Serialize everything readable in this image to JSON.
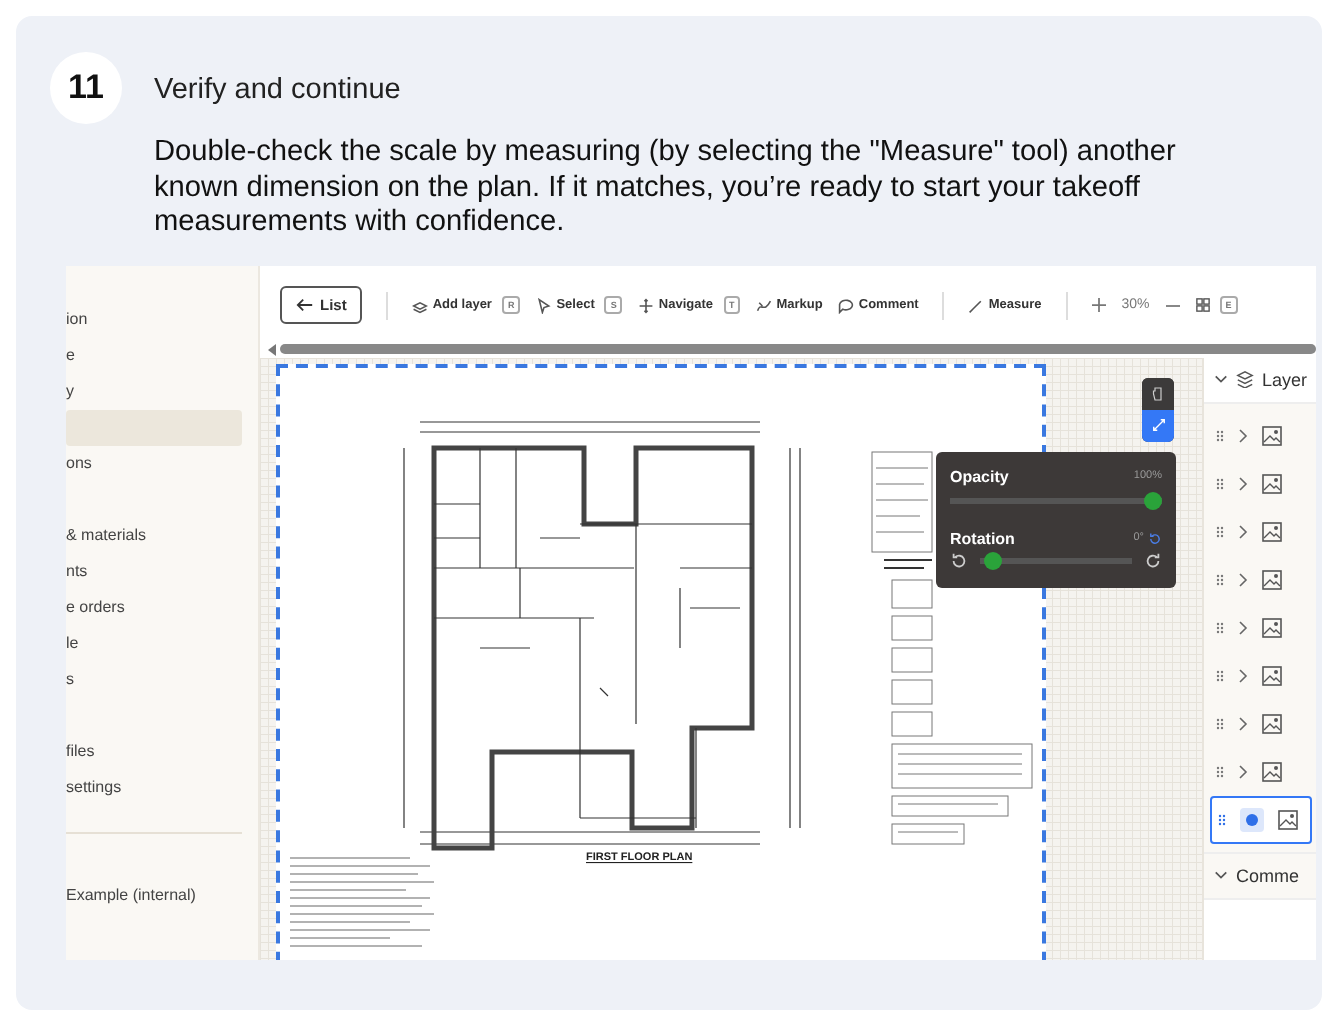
{
  "step": {
    "number": "11",
    "title": "Verify and continue",
    "text": "Double-check the scale by measuring (by selecting the \"Measure\" tool) another known dimension on the plan. If it matches, you’re ready to start your takeoff measurements with confidence."
  },
  "app": {
    "sidebar": {
      "groups": [
        {
          "items": [
            {
              "label": "ion",
              "selected": false
            },
            {
              "label": "e",
              "selected": false
            },
            {
              "label": "y",
              "selected": false
            },
            {
              "selected": true
            },
            {
              "label": "ons",
              "selected": false
            }
          ]
        },
        {
          "items": [
            {
              "label": "& materials",
              "selected": false
            },
            {
              "label": "nts",
              "selected": false
            },
            {
              "label": "e orders",
              "selected": false
            },
            {
              "label": "le",
              "selected": false
            },
            {
              "label": "s",
              "selected": false
            }
          ]
        },
        {
          "items": [
            {
              "label": "files",
              "selected": false
            },
            {
              "label": "settings",
              "selected": false
            }
          ]
        },
        {
          "items": [
            {
              "label": "Example (internal)",
              "selected": false
            }
          ]
        }
      ]
    },
    "toolbar": {
      "back_label": "List",
      "tools": [
        {
          "kind": "add-layer",
          "label": "Add layer",
          "key": "R"
        },
        {
          "kind": "select",
          "label": "Select",
          "key": "S"
        },
        {
          "kind": "navigate",
          "label": "Navigate",
          "key": "T"
        },
        {
          "kind": "markup",
          "label": "Markup"
        },
        {
          "kind": "comment",
          "label": "Comment"
        },
        {
          "kind": "measure",
          "label": "Measure"
        }
      ],
      "zoom": "30%",
      "grid_key": "E"
    },
    "plan": {
      "title": "FIRST FLOOR PLAN"
    },
    "layer_settings": {
      "opacity": {
        "label": "Opacity",
        "reading": "100%",
        "level": 1
      },
      "rotation": {
        "label": "Rotation",
        "reading": "0°",
        "level": 0.03
      }
    },
    "layers_panel": {
      "title": "Layer",
      "rows": [
        {
          "selected": false
        },
        {
          "selected": false
        },
        {
          "selected": false
        },
        {
          "selected": false
        },
        {
          "selected": false
        },
        {
          "selected": false
        },
        {
          "selected": false
        },
        {
          "selected": false
        },
        {
          "selected": true
        }
      ],
      "comments_title": "Comme"
    }
  }
}
